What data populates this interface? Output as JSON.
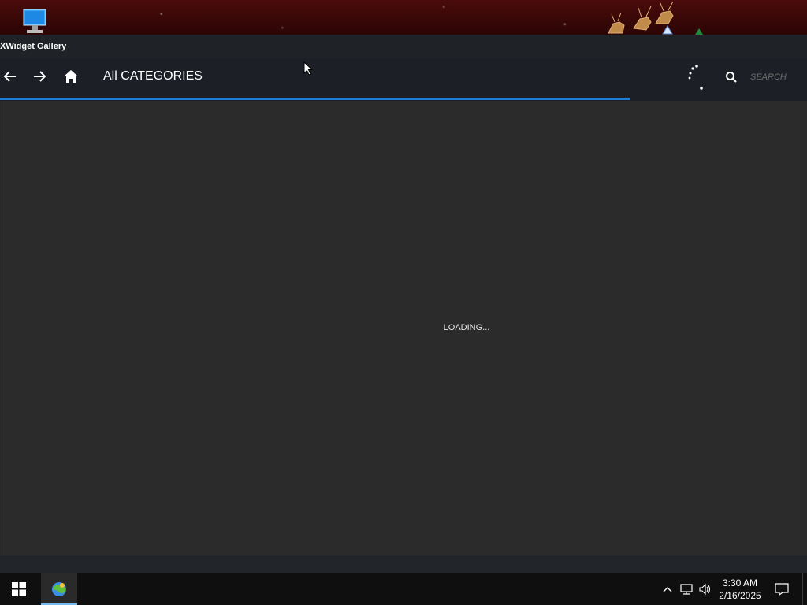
{
  "window": {
    "title": "XWidget Gallery"
  },
  "toolbar": {
    "breadcrumb": "All CATEGORIES",
    "search": {
      "placeholder": "SEARCH",
      "value": ""
    },
    "icons": {
      "back": "arrow-left-icon",
      "forward": "arrow-right-icon",
      "home": "home-icon",
      "search": "search-icon",
      "spinner": "spinner-icon"
    }
  },
  "progress": {
    "fraction": 0.78,
    "color": "#1e7fd8"
  },
  "main": {
    "loading_text": "LOADING..."
  },
  "taskbar": {
    "clock": {
      "time": "3:30 AM",
      "date": "2/16/2025"
    },
    "icons": {
      "start": "windows-logo-icon",
      "app": "xwidget-icon",
      "chevron": "chevron-up-icon",
      "network": "network-icon",
      "volume": "volume-icon",
      "notifications": "notification-icon"
    }
  },
  "colors": {
    "accent": "#1e7fd8",
    "window_bg": "#2a2a2a",
    "toolbar_bg": "#1c2026",
    "taskbar_bg": "#0f0f0f"
  }
}
